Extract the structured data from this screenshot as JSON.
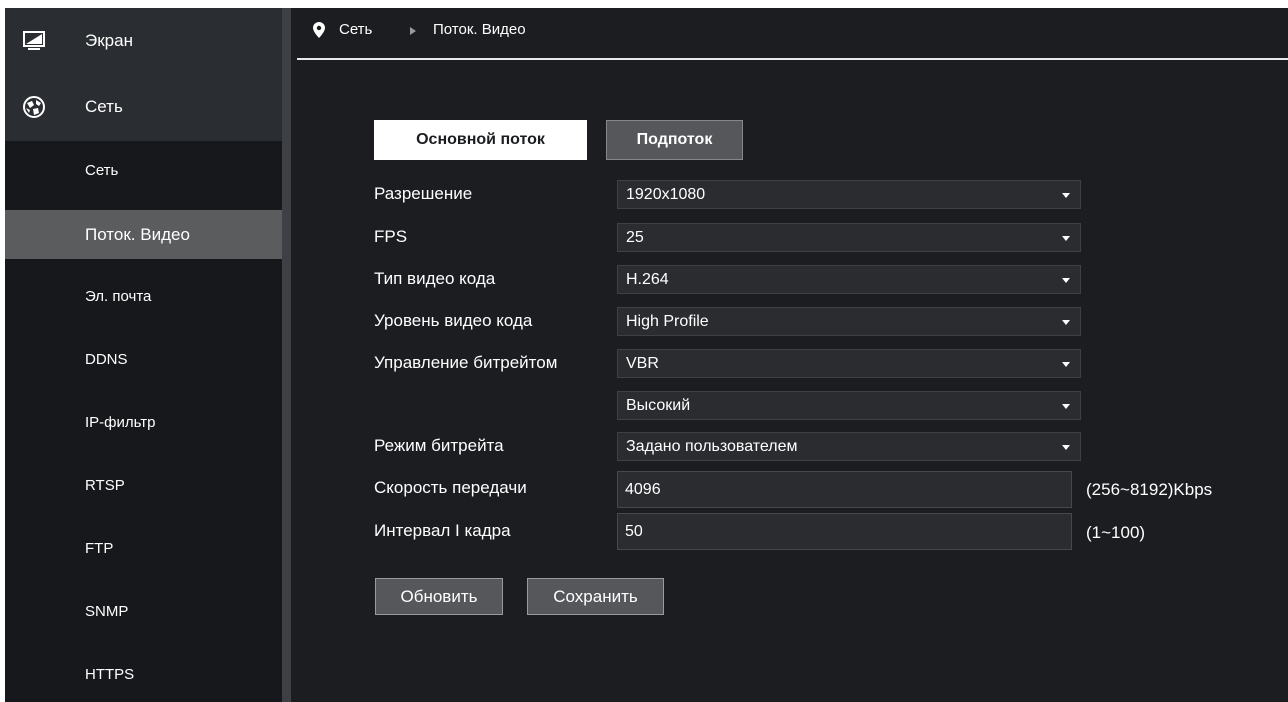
{
  "sidebar": {
    "top": [
      {
        "label": "Экран",
        "icon": "monitor-icon"
      },
      {
        "label": "Сеть",
        "icon": "network-globe-icon"
      }
    ],
    "items": [
      {
        "label": "Сеть"
      },
      {
        "label": "Поток. Видео",
        "active": true
      },
      {
        "label": "Эл. почта"
      },
      {
        "label": "DDNS"
      },
      {
        "label": "IP-фильтр"
      },
      {
        "label": "RTSP"
      },
      {
        "label": "FTP"
      },
      {
        "label": "SNMP"
      },
      {
        "label": "HTTPS"
      }
    ]
  },
  "breadcrumb": {
    "icon": "location-pin-icon",
    "section": "Сеть",
    "page": "Поток. Видео"
  },
  "tabs": {
    "main": "Основной поток",
    "sub": "Подпоток",
    "active": "main"
  },
  "form": {
    "resolution": {
      "label": "Разрешение",
      "value": "1920x1080"
    },
    "fps": {
      "label": "FPS",
      "value": "25"
    },
    "codec": {
      "label": "Тип видео кода",
      "value": "H.264"
    },
    "profile": {
      "label": "Уровень видео кода",
      "value": "High Profile"
    },
    "bitrate_control": {
      "label": "Управление битрейтом",
      "value": "VBR"
    },
    "quality": {
      "label": "",
      "value": "Высокий"
    },
    "bitrate_mode": {
      "label": "Режим битрейта",
      "value": "Задано пользователем"
    },
    "bitrate": {
      "label": "Скорость передачи",
      "value": "4096",
      "hint": "(256~8192)Kbps"
    },
    "iframe": {
      "label": "Интервал I кадра",
      "value": "50",
      "hint": "(1~100)"
    }
  },
  "buttons": {
    "refresh": "Обновить",
    "save": "Сохранить"
  },
  "colors": {
    "background": "#1b1d21",
    "sidebar": "#2a2d31",
    "submenu": "#17181b",
    "active_item": "#5b5c5e",
    "button": "#55575a"
  }
}
